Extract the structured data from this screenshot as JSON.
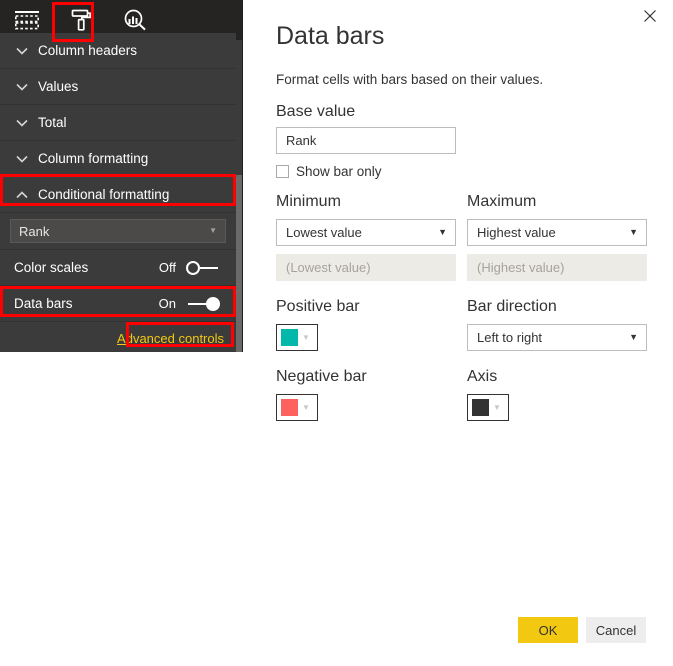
{
  "format_pane": {
    "toolbar": {
      "fields_tab": {
        "name": "Fields",
        "icon": "table-grid-icon"
      },
      "format_tab": {
        "name": "Format",
        "icon": "paint-roller-icon",
        "selected": true,
        "accent": "#f2c811"
      },
      "analytics_tab": {
        "name": "Analytics",
        "icon": "analytics-magnifier-icon"
      }
    },
    "cards": [
      {
        "label": "Column headers",
        "expanded": false
      },
      {
        "label": "Values",
        "expanded": false
      },
      {
        "label": "Total",
        "expanded": false
      },
      {
        "label": "Column formatting",
        "expanded": false
      },
      {
        "label": "Conditional formatting",
        "expanded": true
      }
    ],
    "field_select": {
      "value": "Rank"
    },
    "toggles": [
      {
        "label": "Color scales",
        "state": "Off",
        "on": false
      },
      {
        "label": "Data bars",
        "state": "On",
        "on": true
      }
    ],
    "advanced_link": "Advanced controls"
  },
  "dialog": {
    "title": "Data bars",
    "description": "Format cells with bars based on their values.",
    "close_icon": "close-icon",
    "base_value": {
      "label": "Base value",
      "value": "Rank"
    },
    "show_bar_only": {
      "label": "Show bar only",
      "checked": false
    },
    "minimum": {
      "label": "Minimum",
      "select_value": "Lowest value",
      "input_placeholder": "(Lowest value)",
      "input_value": ""
    },
    "maximum": {
      "label": "Maximum",
      "select_value": "Highest value",
      "input_placeholder": "(Highest value)",
      "input_value": ""
    },
    "positive_bar": {
      "label": "Positive bar",
      "color": "#01b8aa"
    },
    "negative_bar": {
      "label": "Negative bar",
      "color": "#fd625e"
    },
    "bar_direction": {
      "label": "Bar direction",
      "select_value": "Left to right"
    },
    "axis": {
      "label": "Axis",
      "color": "#333333"
    },
    "buttons": {
      "ok": "OK",
      "cancel": "Cancel"
    }
  },
  "annotations": {
    "color": "#ff0000",
    "boxes": [
      "format-tab",
      "conditional-formatting-card",
      "data-bars-row",
      "advanced-controls-link"
    ]
  }
}
